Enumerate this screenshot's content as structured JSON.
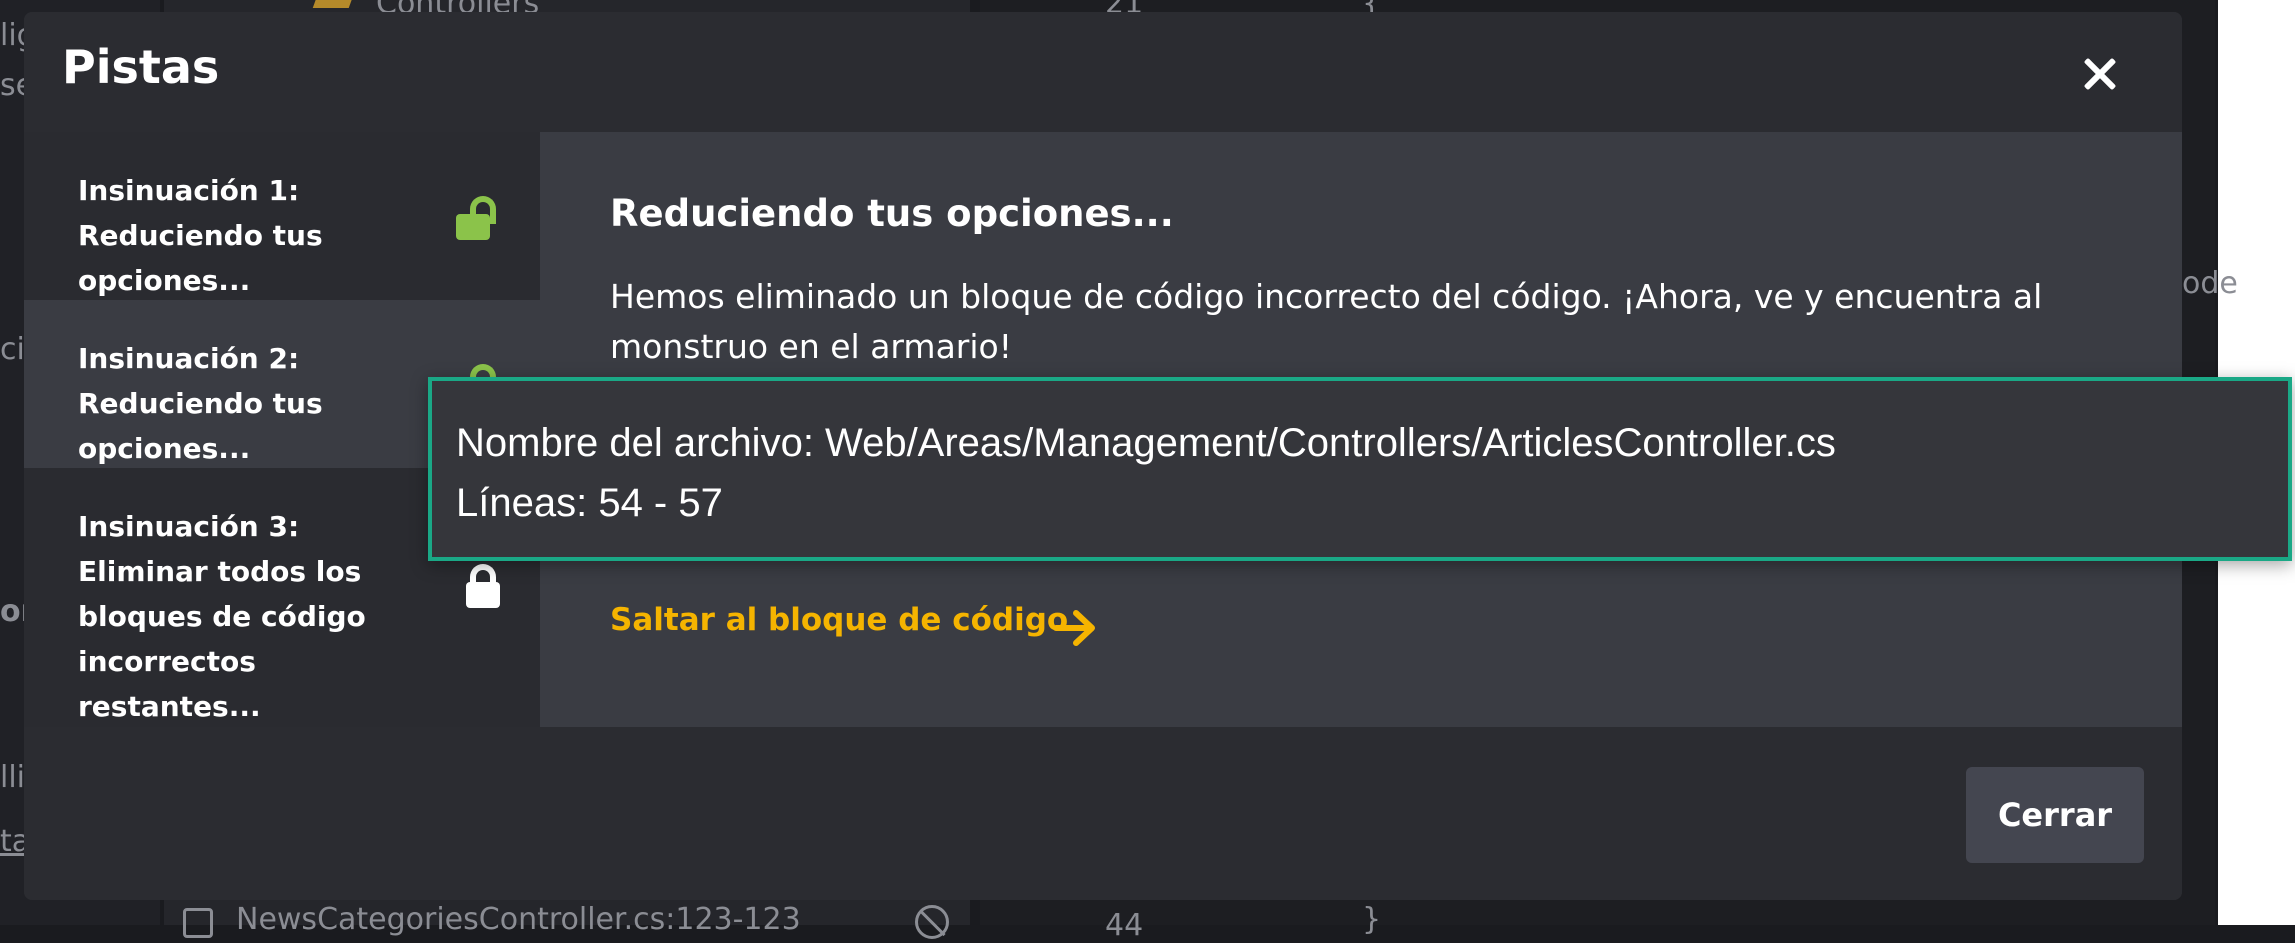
{
  "background": {
    "tree_item": "Controllers",
    "line_number_top": "21",
    "brace_top": "{",
    "frag_left_1": "lig",
    "frag_left_2": "se",
    "frag_left_3": "ci",
    "frag_left_4": "or",
    "frag_left_5": "lli",
    "frag_left_6": "ta",
    "frag_right": "ode",
    "list_item_bottom": "NewsCategoriesController.cs:123-123",
    "line_number_bottom": "44",
    "brace_bottom": "}"
  },
  "modal": {
    "title": "Pistas",
    "hints": [
      {
        "label": "Insinuación 1: Reduciendo tus opciones...",
        "state": "unlocked",
        "icon": "unlocked-lock-icon"
      },
      {
        "label": "Insinuación 2: Reduciendo tus opciones...",
        "state": "unlocked",
        "icon": "unlocked-lock-icon"
      },
      {
        "label": "Insinuación 3: Eliminar todos los bloques de código incorrectos restantes...",
        "state": "locked",
        "icon": "lock-icon"
      }
    ],
    "content": {
      "heading": "Reduciendo tus opciones...",
      "description": "Hemos eliminado un bloque de código incorrecto del código. ¡Ahora, ve y encuentra al monstruo en el armario!",
      "jump_link": "Saltar al bloque de código"
    },
    "footer": {
      "close_label": "Cerrar"
    }
  },
  "tooltip": {
    "file_line": "Nombre del archivo: Web/Areas/Management/Controllers/ArticlesController.cs",
    "lines_line": "Líneas: 54 - 57"
  },
  "colors": {
    "accent_link": "#f5b400",
    "unlocked_icon": "#8bc34a",
    "tooltip_border": "#1aa886"
  }
}
